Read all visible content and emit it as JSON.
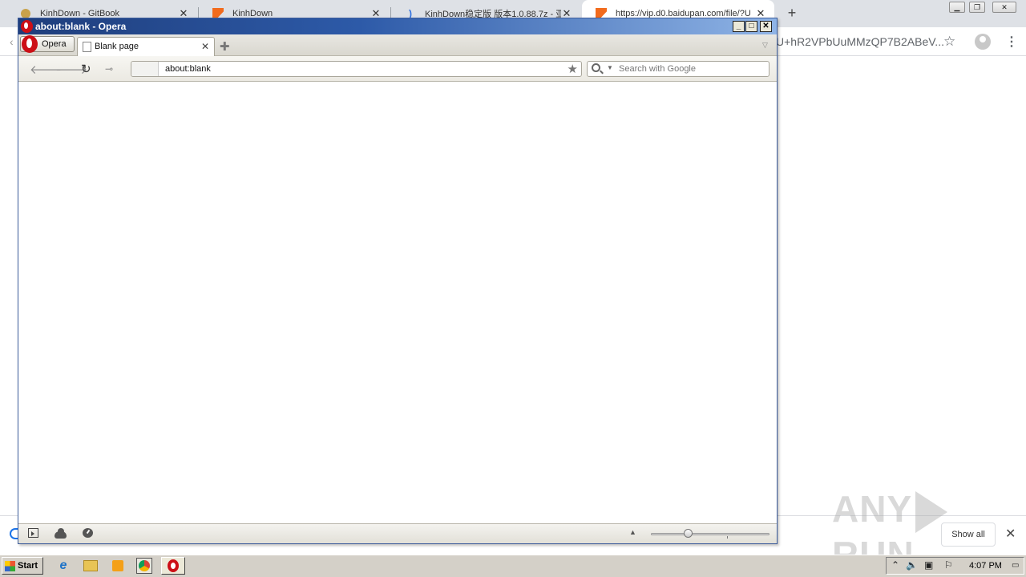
{
  "chrome": {
    "tabs": [
      {
        "title": "KinhDown - GitBook",
        "favicon": "gitbook-icon"
      },
      {
        "title": "KinhDown",
        "favicon": "kinhdown-icon"
      },
      {
        "title": "KinhDown稳定版 版本1.0.88.7z - 亚",
        "favicon": "bracket-icon"
      },
      {
        "title": "https://vip.d0.baidupan.com/file/?U",
        "favicon": "kinhdown-icon"
      }
    ],
    "new_tab_symbol": "+",
    "close_symbol": "✕",
    "url_tail": "U+hR2VPbUuMMzQP7B2ABeV...",
    "downloads": {
      "show_all_label": "Show all"
    },
    "watermark": {
      "left": "ANY",
      "right": "RUN"
    }
  },
  "opera": {
    "window_title": "about:blank - Opera",
    "menu_label": "Opera",
    "tab": {
      "title": "Blank page"
    },
    "address": {
      "url": "about:blank"
    },
    "search": {
      "placeholder": "Search with Google"
    },
    "zoom": {
      "level": 0.3
    }
  },
  "taskbar": {
    "start_label": "Start",
    "clock": "4:07 PM"
  },
  "colors": {
    "opera_red": "#cc0f16",
    "titlebar_blue": "#1f3e7c",
    "chrome_tabstrip": "#dee1e6"
  }
}
